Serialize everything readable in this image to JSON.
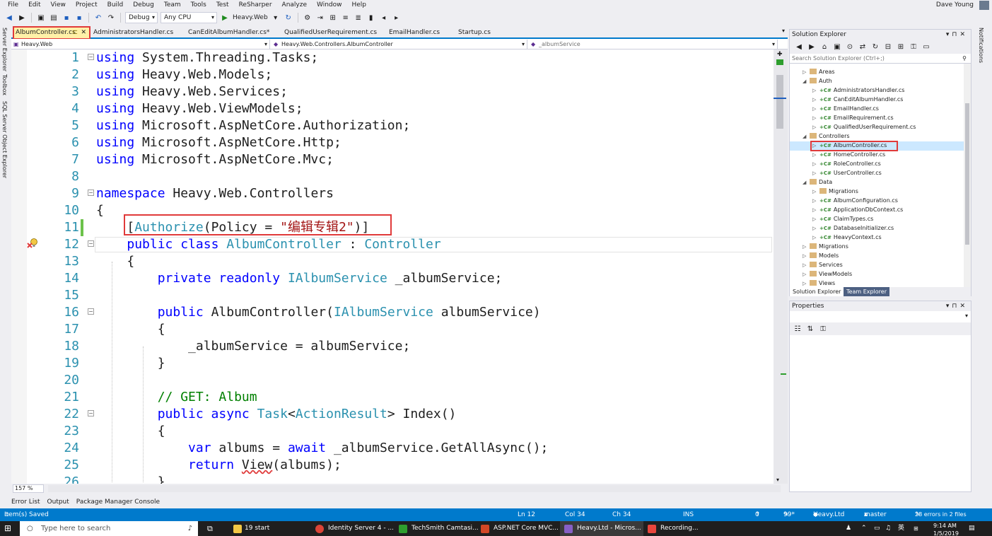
{
  "menu": [
    "File",
    "Edit",
    "View",
    "Project",
    "Build",
    "Debug",
    "Team",
    "Tools",
    "Test",
    "ReSharper",
    "Analyze",
    "Window",
    "Help"
  ],
  "user": {
    "name": "Dave Young"
  },
  "toolbar": {
    "config": "Debug",
    "platform": "Any CPU",
    "start_label": "Heavy.Web"
  },
  "side_labels": [
    "Server Explorer",
    "Toolbox",
    "SQL Server Object Explorer"
  ],
  "right_side_label": "Notifications",
  "tabs": [
    {
      "label": "AlbumController.cs"
    },
    {
      "label": "AdministratorsHandler.cs"
    },
    {
      "label": "CanEditAlbumHandler.cs*"
    },
    {
      "label": "QualifiedUserRequirement.cs"
    },
    {
      "label": "EmailHandler.cs"
    },
    {
      "label": "Startup.cs"
    }
  ],
  "navbar": {
    "project": "Heavy.Web",
    "type": "Heavy.Web.Controllers.AlbumController",
    "member": "_albumService"
  },
  "code_lines": [
    {
      "n": "1",
      "tokens": [
        [
          "kw",
          "using"
        ],
        [
          "pl",
          " System.Threading.Tasks;"
        ]
      ]
    },
    {
      "n": "2",
      "tokens": [
        [
          "kw",
          "using"
        ],
        [
          "pl",
          " Heavy.Web.Models;"
        ]
      ]
    },
    {
      "n": "3",
      "tokens": [
        [
          "kw",
          "using"
        ],
        [
          "pl",
          " Heavy.Web.Services;"
        ]
      ]
    },
    {
      "n": "4",
      "tokens": [
        [
          "kw",
          "using"
        ],
        [
          "pl",
          " Heavy.Web.ViewModels;"
        ]
      ]
    },
    {
      "n": "5",
      "tokens": [
        [
          "kw",
          "using"
        ],
        [
          "pl",
          " Microsoft.AspNetCore.Authorization;"
        ]
      ]
    },
    {
      "n": "6",
      "tokens": [
        [
          "kw",
          "using"
        ],
        [
          "pl",
          " Microsoft.AspNetCore.Http;"
        ]
      ]
    },
    {
      "n": "7",
      "tokens": [
        [
          "kw",
          "using"
        ],
        [
          "pl",
          " Microsoft.AspNetCore.Mvc;"
        ]
      ]
    },
    {
      "n": "8",
      "tokens": []
    },
    {
      "n": "9",
      "tokens": [
        [
          "kw",
          "namespace"
        ],
        [
          "pl",
          " Heavy.Web.Controllers"
        ]
      ]
    },
    {
      "n": "10",
      "tokens": [
        [
          "pl",
          "{"
        ]
      ]
    },
    {
      "n": "11",
      "tokens": [
        [
          "pl",
          "    ["
        ],
        [
          "ty",
          "Authorize"
        ],
        [
          "pl",
          "(Policy = "
        ],
        [
          "str",
          "\"编辑专辑2\""
        ],
        [
          "pl",
          ")]"
        ]
      ]
    },
    {
      "n": "12",
      "tokens": [
        [
          "pl",
          "    "
        ],
        [
          "kw",
          "public class"
        ],
        [
          "pl",
          " "
        ],
        [
          "ty",
          "AlbumController"
        ],
        [
          "pl",
          " : "
        ],
        [
          "ty",
          "Controller"
        ]
      ]
    },
    {
      "n": "13",
      "tokens": [
        [
          "pl",
          "    {"
        ]
      ]
    },
    {
      "n": "14",
      "tokens": [
        [
          "pl",
          "        "
        ],
        [
          "kw",
          "private readonly"
        ],
        [
          "pl",
          " "
        ],
        [
          "ty",
          "IAlbumService"
        ],
        [
          "pl",
          " _albumService;"
        ]
      ]
    },
    {
      "n": "15",
      "tokens": []
    },
    {
      "n": "16",
      "tokens": [
        [
          "pl",
          "        "
        ],
        [
          "kw",
          "public"
        ],
        [
          "pl",
          " AlbumController("
        ],
        [
          "ty",
          "IAlbumService"
        ],
        [
          "pl",
          " albumService)"
        ]
      ]
    },
    {
      "n": "17",
      "tokens": [
        [
          "pl",
          "        {"
        ]
      ]
    },
    {
      "n": "18",
      "tokens": [
        [
          "pl",
          "            _albumService = albumService;"
        ]
      ]
    },
    {
      "n": "19",
      "tokens": [
        [
          "pl",
          "        }"
        ]
      ]
    },
    {
      "n": "20",
      "tokens": []
    },
    {
      "n": "21",
      "tokens": [
        [
          "cm",
          "        // GET: Album"
        ]
      ]
    },
    {
      "n": "22",
      "tokens": [
        [
          "pl",
          "        "
        ],
        [
          "kw",
          "public async"
        ],
        [
          "pl",
          " "
        ],
        [
          "ty",
          "Task"
        ],
        [
          "pl",
          "<"
        ],
        [
          "ty",
          "ActionResult"
        ],
        [
          "pl",
          "> Index()"
        ]
      ]
    },
    {
      "n": "23",
      "tokens": [
        [
          "pl",
          "        {"
        ]
      ]
    },
    {
      "n": "24",
      "tokens": [
        [
          "pl",
          "            "
        ],
        [
          "kw",
          "var"
        ],
        [
          "pl",
          " albums = "
        ],
        [
          "kw",
          "await"
        ],
        [
          "pl",
          " _albumService.GetAllAsync();"
        ]
      ]
    },
    {
      "n": "25",
      "tokens": [
        [
          "pl",
          "            "
        ],
        [
          "kw",
          "return"
        ],
        [
          "pl",
          " "
        ],
        [
          "sq",
          "View"
        ],
        [
          "pl",
          "(albums);"
        ]
      ]
    },
    {
      "n": "26",
      "tokens": [
        [
          "pl",
          "        }"
        ]
      ]
    }
  ],
  "zoom": "157 %",
  "solution_explorer": {
    "title": "Solution Explorer",
    "search_placeholder": "Search Solution Explorer (Ctrl+;)",
    "items": [
      {
        "label": "Areas",
        "kind": "folder",
        "depth": 1,
        "arrow": "▷"
      },
      {
        "label": "Auth",
        "kind": "folder",
        "depth": 1,
        "arrow": "◢"
      },
      {
        "label": "AdministratorsHandler.cs",
        "kind": "cs",
        "depth": 2,
        "arrow": "▷"
      },
      {
        "label": "CanEditAlbumHandler.cs",
        "kind": "cs",
        "depth": 2,
        "arrow": "▷"
      },
      {
        "label": "EmailHandler.cs",
        "kind": "cs",
        "depth": 2,
        "arrow": "▷"
      },
      {
        "label": "EmailRequirement.cs",
        "kind": "cs",
        "depth": 2,
        "arrow": "▷"
      },
      {
        "label": "QualifiedUserRequirement.cs",
        "kind": "cs",
        "depth": 2,
        "arrow": "▷"
      },
      {
        "label": "Controllers",
        "kind": "folder",
        "depth": 1,
        "arrow": "◢"
      },
      {
        "label": "AlbumController.cs",
        "kind": "cs",
        "depth": 2,
        "arrow": "▷"
      },
      {
        "label": "HomeController.cs",
        "kind": "cs",
        "depth": 2,
        "arrow": "▷"
      },
      {
        "label": "RoleController.cs",
        "kind": "cs",
        "depth": 2,
        "arrow": "▷"
      },
      {
        "label": "UserController.cs",
        "kind": "cs",
        "depth": 2,
        "arrow": "▷"
      },
      {
        "label": "Data",
        "kind": "folder",
        "depth": 1,
        "arrow": "◢"
      },
      {
        "label": "Migrations",
        "kind": "folder",
        "depth": 2,
        "arrow": "▷"
      },
      {
        "label": "AlbumConfiguration.cs",
        "kind": "cs",
        "depth": 2,
        "arrow": "▷"
      },
      {
        "label": "ApplicationDbContext.cs",
        "kind": "cs",
        "depth": 2,
        "arrow": "▷"
      },
      {
        "label": "ClaimTypes.cs",
        "kind": "cs",
        "depth": 2,
        "arrow": "▷"
      },
      {
        "label": "DatabaseInitializer.cs",
        "kind": "cs",
        "depth": 2,
        "arrow": "▷"
      },
      {
        "label": "HeavyContext.cs",
        "kind": "cs",
        "depth": 2,
        "arrow": "▷"
      },
      {
        "label": "Migrations",
        "kind": "folder",
        "depth": 1,
        "arrow": "▷"
      },
      {
        "label": "Models",
        "kind": "folder",
        "depth": 1,
        "arrow": "▷"
      },
      {
        "label": "Services",
        "kind": "folder",
        "depth": 1,
        "arrow": "▷"
      },
      {
        "label": "ViewModels",
        "kind": "folder",
        "depth": 1,
        "arrow": "▷"
      },
      {
        "label": "Views",
        "kind": "folder",
        "depth": 1,
        "arrow": "▷"
      }
    ],
    "tabs": [
      "Solution Explorer",
      "Team Explorer"
    ]
  },
  "properties": {
    "title": "Properties"
  },
  "bottom_tabs": [
    "Error List",
    "Output",
    "Package Manager Console"
  ],
  "status": {
    "message": "Item(s) Saved",
    "ln": "Ln 12",
    "col": "Col 34",
    "ch": "Ch 34",
    "mode": "INS",
    "up": "0",
    "edits": "99*",
    "repo": "Heavy.Ltd",
    "branch": "master",
    "errors": "28 errors in 2 files"
  },
  "taskbar": {
    "search_placeholder": "Type here to search",
    "items": [
      "19 start",
      "Identity Server 4 - ...",
      "TechSmith Camtasi...",
      "ASP.NET Core MVC...",
      "Heavy.Ltd - Micros...",
      "Recording..."
    ],
    "lang": "英",
    "time": "9:14 AM",
    "date": "1/5/2019"
  },
  "colors": {
    "accent": "#007acc",
    "highlight_box": "#e03a3a",
    "keyword": "#0000ff",
    "type": "#2b91af",
    "string": "#a31515",
    "comment": "#008000"
  }
}
